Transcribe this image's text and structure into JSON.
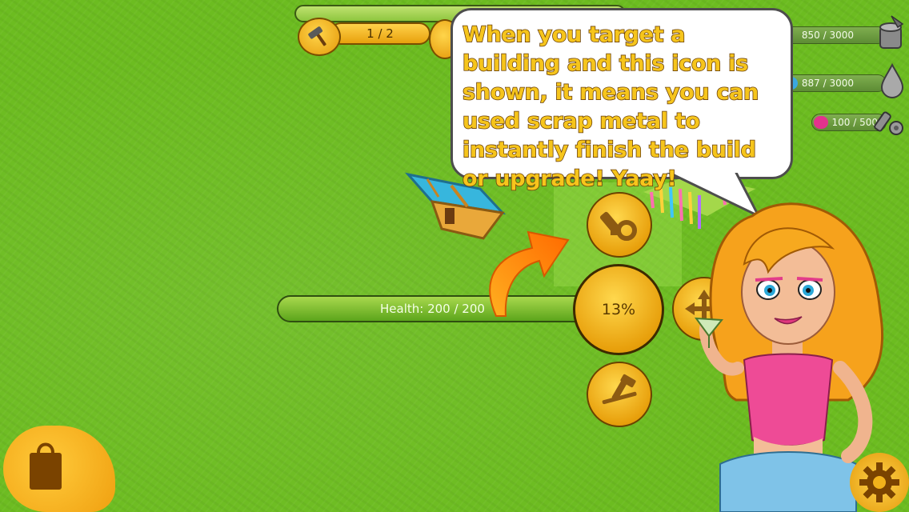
{
  "hud": {
    "build_counter": "1 / 2"
  },
  "resources": [
    {
      "name": "wood",
      "value": 850,
      "max": 3000,
      "label": "850 / 3000",
      "color": "#f2a71b",
      "icon": "log-icon"
    },
    {
      "name": "water",
      "value": 887,
      "max": 3000,
      "label": "887 / 3000",
      "color": "#3aa8e0",
      "icon": "water-drop-icon"
    },
    {
      "name": "scrap-metal",
      "value": 100,
      "max": 500,
      "label": "100 / 500",
      "color": "#e2338d",
      "icon": "scrap-metal-icon"
    }
  ],
  "tutorial": {
    "message": "When you target a building and this icon is shown, it means you can used scrap metal to instantly finish the build or upgrade! Yaay!"
  },
  "building": {
    "health_label": "Health: 200 / 200",
    "progress_label": "13%",
    "progress": 0.13
  },
  "actions": [
    {
      "name": "scrap-metal-finish",
      "icon": "scrap-metal-icon"
    },
    {
      "name": "move",
      "icon": "move-arrows-icon"
    },
    {
      "name": "repair",
      "icon": "hammer-icon"
    }
  ],
  "colors": {
    "grass": "#6cbc20",
    "button_gold": "#f0b020",
    "text_gold": "#f6c51c"
  }
}
